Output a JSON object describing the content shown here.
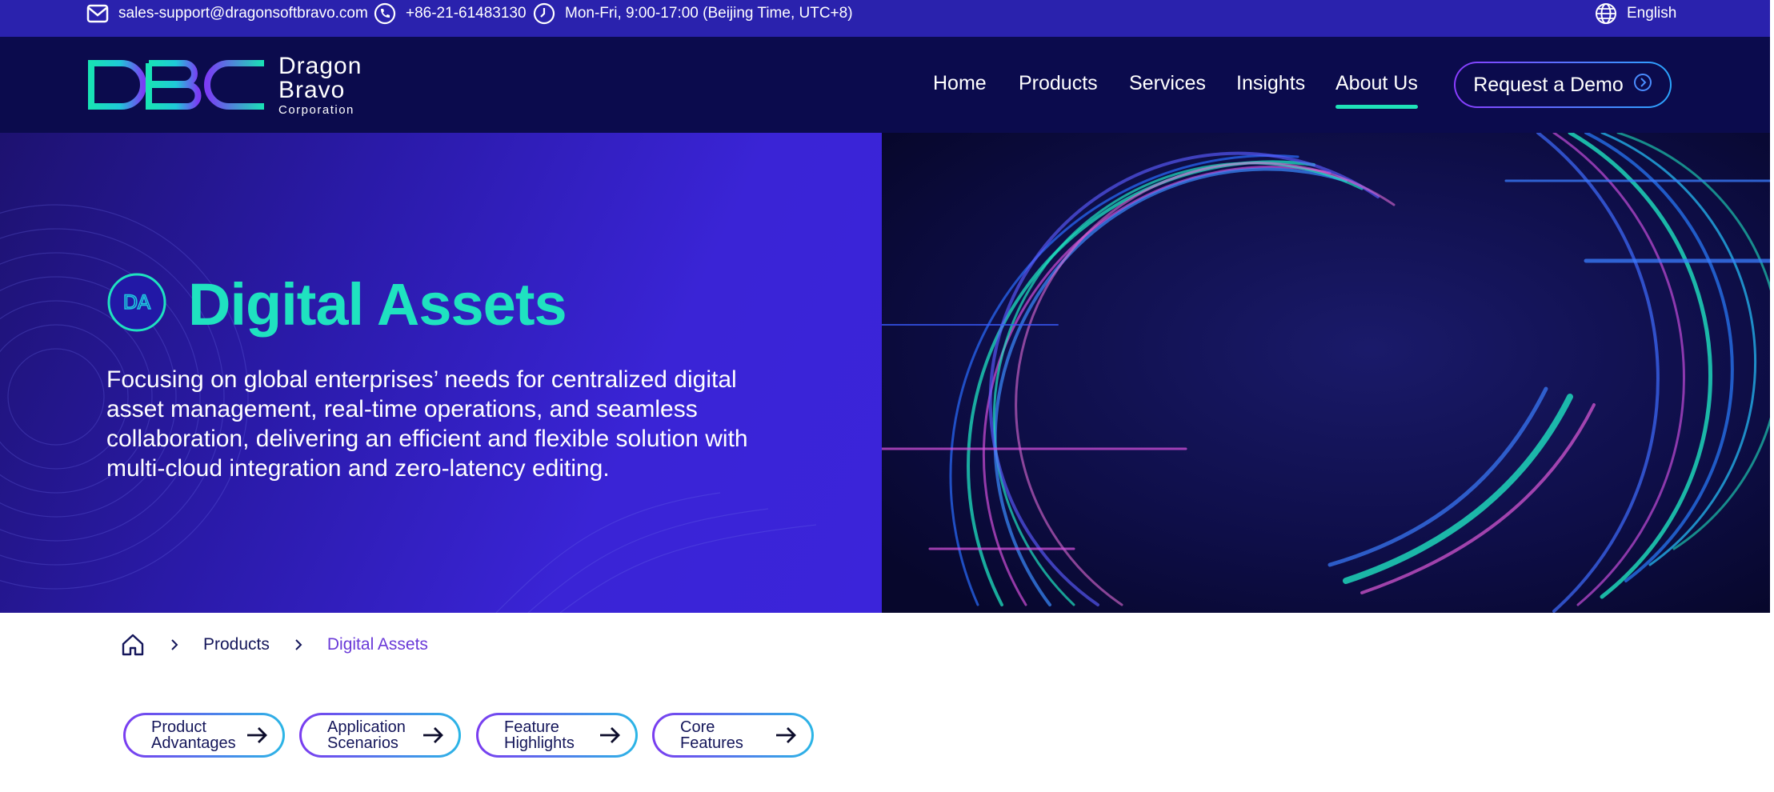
{
  "topbar": {
    "email": "sales-support@dragonsoftbravo.com",
    "phone": "+86-21-61483130",
    "hours": "Mon-Fri, 9:00-17:00 (Beijing Time, UTC+8)",
    "language": "English",
    "icons": [
      "mail-icon",
      "phone-icon",
      "clock-icon",
      "globe-icon"
    ]
  },
  "header": {
    "logo": {
      "mark": "DBC",
      "line1": "Dragon",
      "line2": "Bravo",
      "line3": "Corporation"
    },
    "nav": [
      {
        "label": "Home"
      },
      {
        "label": "Products"
      },
      {
        "label": "Services"
      },
      {
        "label": "Insights"
      },
      {
        "label": "About Us",
        "active": true
      }
    ],
    "cta_label": "Request a Demo"
  },
  "hero": {
    "badge": "DA",
    "title": "Digital Assets",
    "description": "Focusing on global enterprises’ needs for centralized digital asset management, real-time operations, and seamless collaboration, delivering an efficient and flexible solution with multi-cloud integration and zero-latency editing."
  },
  "breadcrumb": {
    "items": [
      "Products",
      "Digital Assets"
    ]
  },
  "anchors": [
    {
      "label": "Product Advantages"
    },
    {
      "label": "Application Scenarios"
    },
    {
      "label": "Feature Highlights"
    },
    {
      "label": "Core Features"
    }
  ],
  "colors": {
    "topbar": "#2a22ad",
    "header": "#0b0b4d",
    "accent": "#1fe2c0",
    "breadcrumb_current": "#6a3ad8"
  }
}
